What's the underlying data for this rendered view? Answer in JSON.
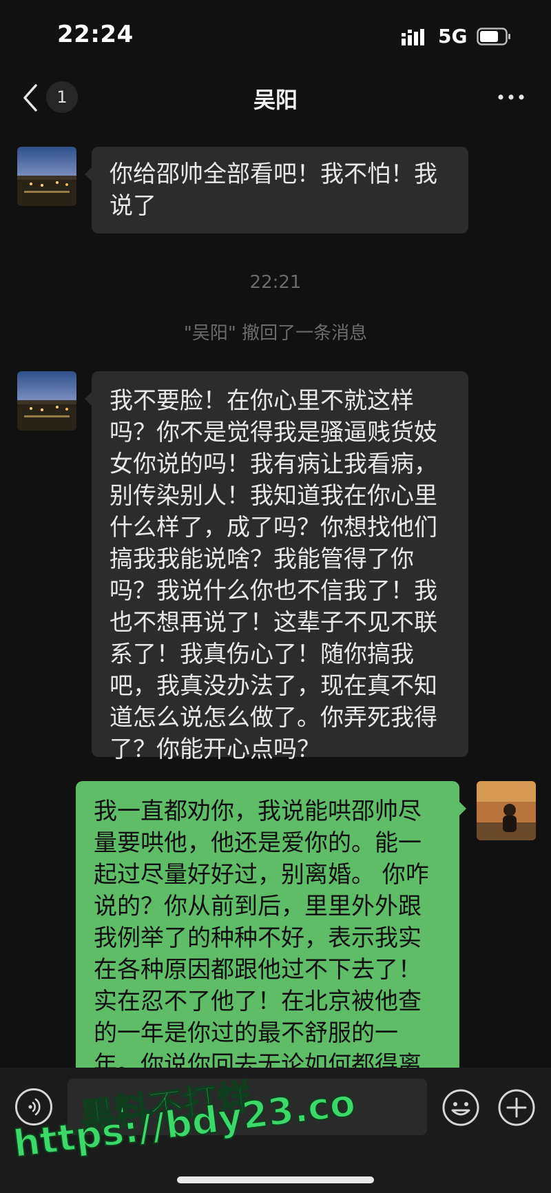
{
  "status_bar": {
    "time": "22:24",
    "network": "5G"
  },
  "nav": {
    "back_icon": "chevron-left-icon",
    "unread_count": "1",
    "title": "吴阳",
    "more_icon": "more-dots-icon"
  },
  "messages": [
    {
      "direction": "incoming",
      "text": "你给邵帅全部看吧！我不怕！我\n说了"
    },
    {
      "direction": "incoming",
      "text": "我不要脸！在你心里不就这样\n吗？你不是觉得我是骚逼贱货妓\n女你说的吗！我有病让我看病，\n别传染别人！我知道我在你心里\n什么样了，成了吗？你想找他们\n搞我我能说啥？我能管得了你\n吗？我说什么你也不信我了！我\n也不想再说了！这辈子不见不联\n系了！我真伤心了！随你搞我\n吧，我真没办法了，现在真不知\n道怎么说怎么做了。你弄死我得\n了？你能开心点吗？"
    },
    {
      "direction": "outgoing",
      "text": "我一直都劝你，我说能哄邵帅尽\n量要哄他，他还是爱你的。能一\n起过尽量好好过，别离婚。 你咋\n说的？你从前到后，里里外外跟\n我例举了的种种不好，表示我实\n在各种原因都跟他过不下去了！\n实在忍不了他了！在北京被他查\n的一年是你过的最不舒服的一\n年。你说你回去无论如何都得离"
    }
  ],
  "system": {
    "timestamp": "22:21",
    "recall_notice": "\"吴阳\" 撤回了一条消息"
  },
  "input_bar": {
    "voice_icon": "voice-icon",
    "emoji_icon": "emoji-icon",
    "plus_icon": "plus-icon"
  },
  "watermark": {
    "line1": "黑料不打烊",
    "line2": "https://bdy23.co"
  },
  "colors": {
    "background": "#111111",
    "incoming_bubble": "#2c2c2c",
    "outgoing_bubble": "#5fbd68",
    "watermark": "#3cd86a"
  }
}
